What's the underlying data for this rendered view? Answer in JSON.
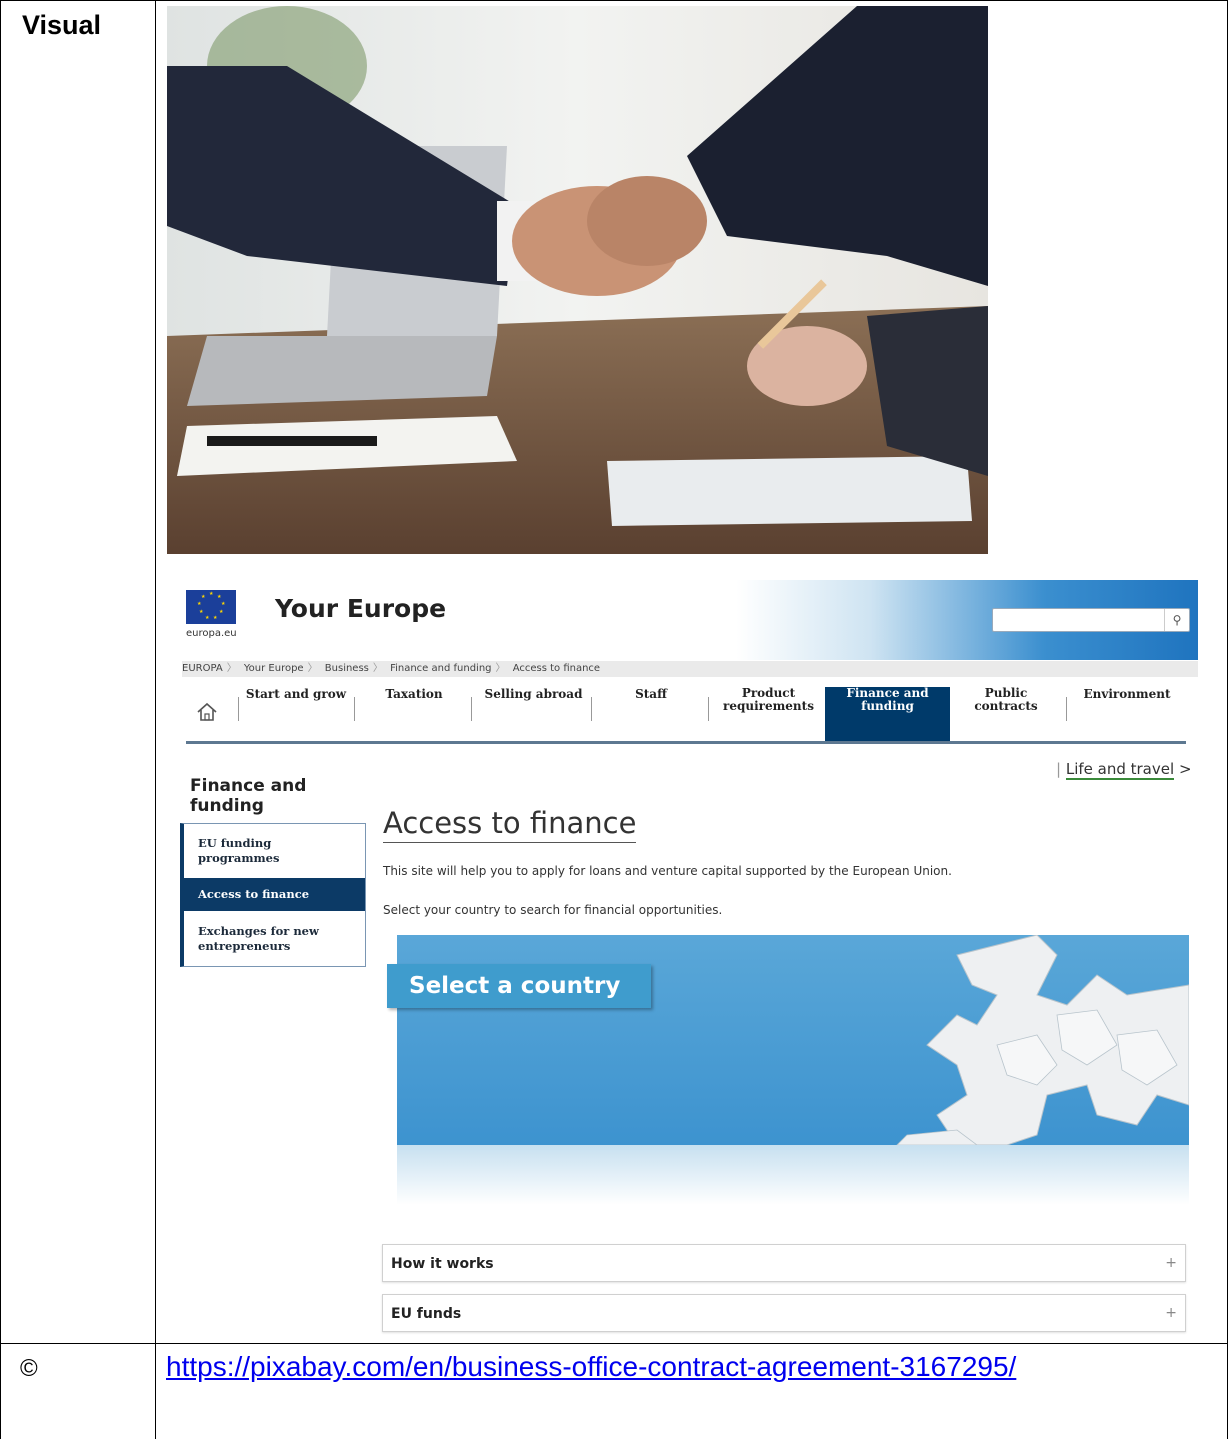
{
  "table": {
    "visual_label": "Visual",
    "copyright_symbol": "©",
    "source_link": "https://pixabay.com/en/business-office-contract-agreement-3167295/"
  },
  "site": {
    "title": "Your Europe",
    "domain_label": "europa.eu",
    "search_placeholder": "",
    "breadcrumb": [
      "EUROPA",
      "Your Europe",
      "Business",
      "Finance and funding",
      "Access to finance"
    ],
    "nav": [
      {
        "label": "Start and grow",
        "active": false
      },
      {
        "label": "Taxation",
        "active": false
      },
      {
        "label": "Selling abroad",
        "active": false
      },
      {
        "label": "Staff",
        "active": false
      },
      {
        "label": "Product requirements",
        "active": false
      },
      {
        "label": "Finance and funding",
        "active": true
      },
      {
        "label": "Public contracts",
        "active": false
      },
      {
        "label": "Environment",
        "active": false
      }
    ],
    "life_travel": "Life and travel",
    "life_travel_arrow": ">",
    "sidebar": {
      "title": "Finance and funding",
      "items": [
        {
          "label": "EU funding programmes",
          "active": false
        },
        {
          "label": "Access to finance",
          "active": true
        },
        {
          "label": "Exchanges for new entrepreneurs",
          "active": false
        }
      ]
    },
    "page_title": "Access to finance",
    "intro": "This site will help you to apply for loans and venture capital supported by the European Union.",
    "instruction": "Select your country to search for financial opportunities.",
    "select_country": "Select a country",
    "accordions": [
      {
        "label": "How it works",
        "icon": "+"
      },
      {
        "label": "EU funds",
        "icon": "+"
      }
    ],
    "colors": {
      "nav_active": "#003a6a",
      "sidebar_active": "#0c3a66",
      "select_button": "#3f9ccd",
      "map_sea": "#4a9dd3"
    }
  }
}
